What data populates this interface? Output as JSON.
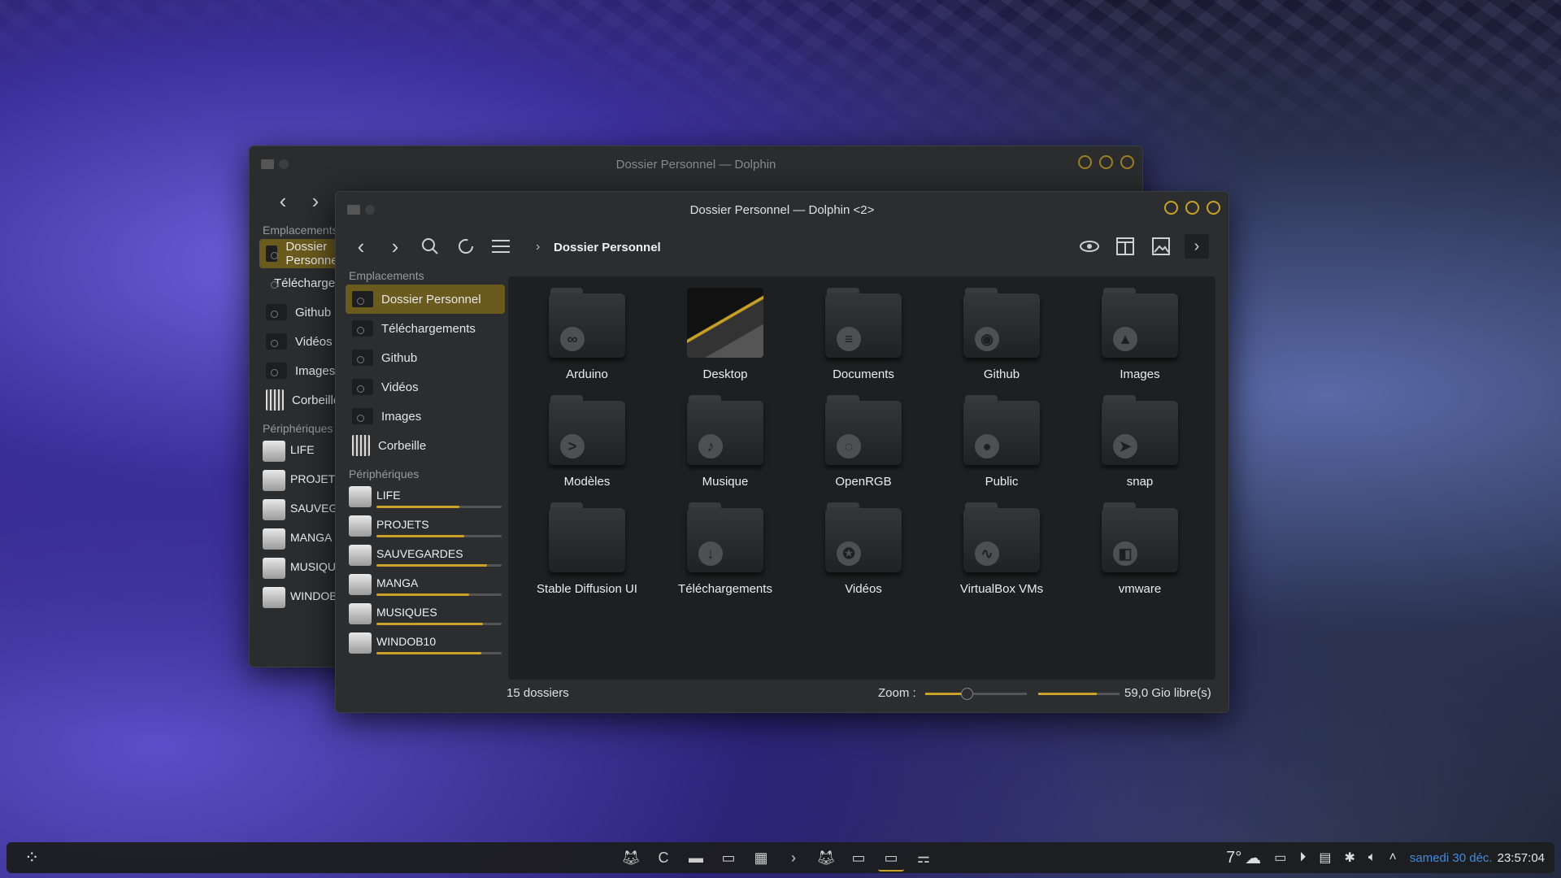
{
  "back_window": {
    "title": "Dossier Personnel — Dolphin",
    "places_header": "Emplacements",
    "places": [
      "Dossier Personnel",
      "Téléchargements",
      "Github",
      "Vidéos",
      "Images",
      "Corbeille"
    ],
    "devices_header": "Périphériques",
    "devices": [
      "LIFE",
      "PROJETS",
      "SAUVEGARDES",
      "MANGA",
      "MUSIQUES",
      "WINDOB10"
    ]
  },
  "front_window": {
    "title": "Dossier Personnel — Dolphin <2>",
    "toolbar": {
      "back_icon": "back-arrow-icon",
      "forward_icon": "forward-arrow-icon",
      "search_icon": "search-icon",
      "refresh_icon": "refresh-icon",
      "menu_icon": "hamburger-menu-icon",
      "breadcrumb": "Dossier Personnel",
      "right_icons": [
        "preview-eye-icon",
        "split-view-icon",
        "image-preview-icon",
        "more-chevron-icon"
      ]
    },
    "sidebar": {
      "places_header": "Emplacements",
      "places": [
        {
          "label": "Dossier Personnel",
          "selected": true
        },
        {
          "label": "Téléchargements",
          "selected": false
        },
        {
          "label": "Github",
          "selected": false
        },
        {
          "label": "Vidéos",
          "selected": false
        },
        {
          "label": "Images",
          "selected": false
        },
        {
          "label": "Corbeille",
          "selected": false
        }
      ],
      "devices_header": "Périphériques",
      "devices": [
        {
          "label": "LIFE",
          "usage": 0.66
        },
        {
          "label": "PROJETS",
          "usage": 0.7
        },
        {
          "label": "SAUVEGARDES",
          "usage": 0.88
        },
        {
          "label": "MANGA",
          "usage": 0.74
        },
        {
          "label": "MUSIQUES",
          "usage": 0.85
        },
        {
          "label": "WINDOB10",
          "usage": 0.84
        }
      ]
    },
    "folders": [
      {
        "name": "Arduino",
        "emblem": "∞"
      },
      {
        "name": "Desktop",
        "emblem": ""
      },
      {
        "name": "Documents",
        "emblem": "≡"
      },
      {
        "name": "Github",
        "emblem": "◉"
      },
      {
        "name": "Images",
        "emblem": "▲"
      },
      {
        "name": "Modèles",
        "emblem": ">"
      },
      {
        "name": "Musique",
        "emblem": "♪"
      },
      {
        "name": "OpenRGB",
        "emblem": "◌"
      },
      {
        "name": "Public",
        "emblem": "●"
      },
      {
        "name": "snap",
        "emblem": "➤"
      },
      {
        "name": "Stable Diffusion UI",
        "emblem": ""
      },
      {
        "name": "Téléchargements",
        "emblem": "↓"
      },
      {
        "name": "Vidéos",
        "emblem": "✪"
      },
      {
        "name": "VirtualBox VMs",
        "emblem": "∿"
      },
      {
        "name": "vmware",
        "emblem": "◧"
      }
    ],
    "status": {
      "count": "15 dossiers",
      "zoom_label": "Zoom :",
      "zoom_level": 0.4,
      "free_fraction": 0.72,
      "free_label": "59,0 Gio libre(s)"
    }
  },
  "taskbar": {
    "launcher_icon": "app-launcher-icon",
    "tasks": [
      "firefox-icon",
      "browser-c-icon",
      "files-icon",
      "folder-icon",
      "calendar-icon",
      "terminal-icon",
      "firefox-audio-icon",
      "dolphin-icon",
      "dolphin-2-icon",
      "konsole-icon"
    ],
    "weather_temp": "7°",
    "weather_icon": "cloud-icon",
    "tray_icons": [
      "display-icon",
      "media-play-icon",
      "clipboard-icon",
      "network-icon",
      "volume-icon",
      "expand-tray-icon"
    ],
    "date": "samedi 30 déc.",
    "time": "23:57:04"
  },
  "colors": {
    "accent": "#c9a227",
    "selection": "#6b5a1e",
    "date": "#3f8ae2"
  }
}
